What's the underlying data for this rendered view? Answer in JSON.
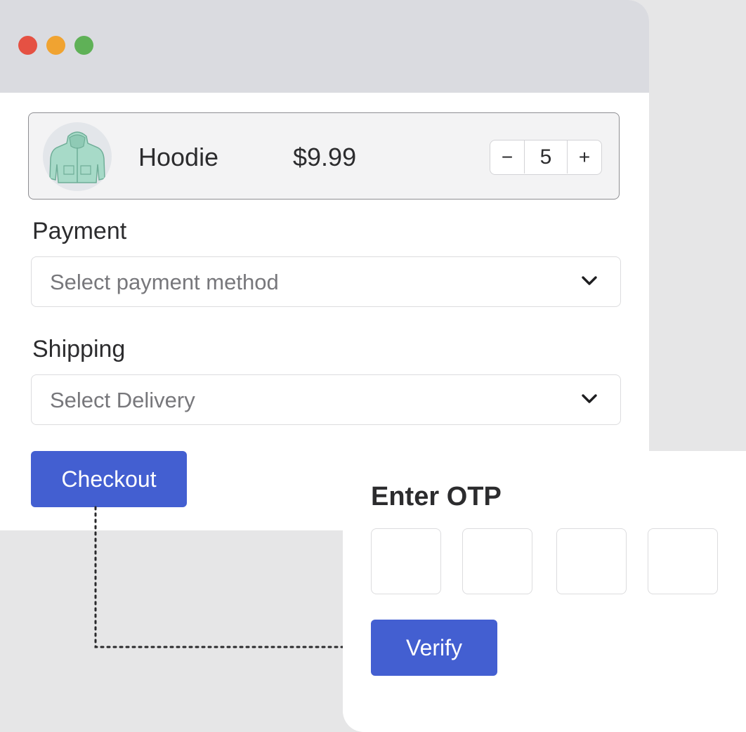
{
  "window": {
    "controls": [
      "close",
      "minimize",
      "maximize"
    ]
  },
  "product": {
    "name": "Hoodie",
    "price": "$9.99",
    "quantity": "5",
    "decrement_label": "−",
    "increment_label": "+",
    "image_icon": "hoodie-icon"
  },
  "payment": {
    "label": "Payment",
    "placeholder": "Select payment method"
  },
  "shipping": {
    "label": "Shipping",
    "placeholder": "Select Delivery"
  },
  "checkout": {
    "label": "Checkout"
  },
  "otp": {
    "title": "Enter OTP",
    "digits": [
      "",
      "",
      "",
      ""
    ],
    "verify_label": "Verify"
  },
  "colors": {
    "accent": "#435fd1",
    "close": "#e55143",
    "minimize": "#f0a331",
    "maximize": "#5fb157"
  }
}
